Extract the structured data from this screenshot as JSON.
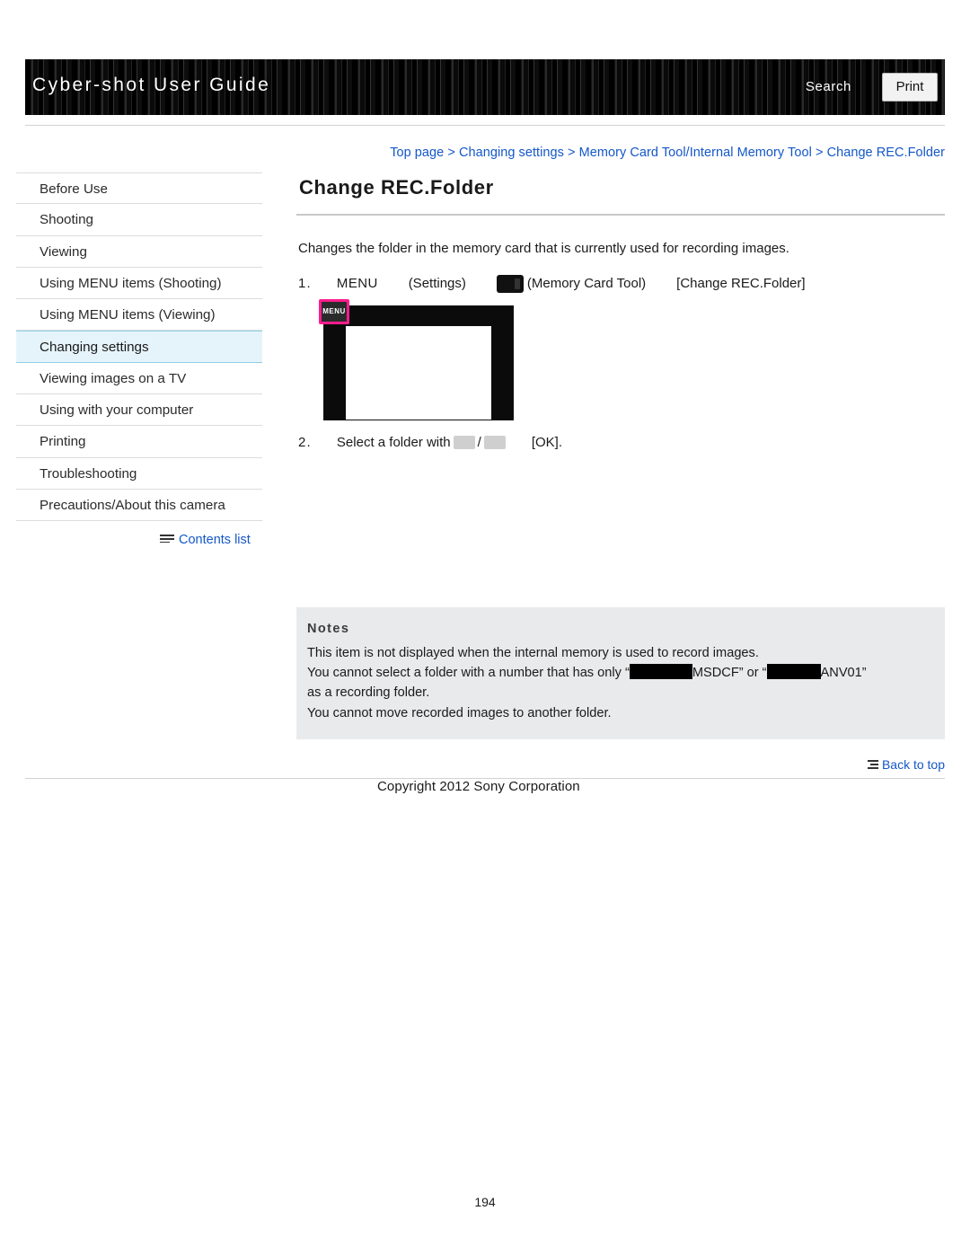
{
  "header": {
    "title": "Cyber-shot User Guide",
    "search_label": "Search",
    "print_label": "Print"
  },
  "breadcrumb": {
    "items": [
      "Top page",
      "Changing settings",
      "Memory Card Tool/Internal Memory Tool",
      "Change REC.Folder"
    ],
    "separator": ">"
  },
  "sidebar": {
    "items": [
      {
        "label": "Before Use"
      },
      {
        "label": "Shooting"
      },
      {
        "label": "Viewing"
      },
      {
        "label": "Using MENU items (Shooting)"
      },
      {
        "label": "Using MENU items (Viewing)"
      },
      {
        "label": "Changing settings"
      },
      {
        "label": "Viewing images on a TV"
      },
      {
        "label": "Using with your computer"
      },
      {
        "label": "Printing"
      },
      {
        "label": "Troubleshooting"
      },
      {
        "label": "Precautions/About this camera"
      }
    ],
    "active_index": 5,
    "contents_list_label": "Contents list"
  },
  "main": {
    "title": "Change REC.Folder",
    "intro": "Changes the folder in the memory card that is currently used for recording images.",
    "step1": {
      "number": "1.",
      "menu": "MENU",
      "settings": "(Settings)",
      "memory_card_tool": "(Memory Card Tool)",
      "target": "[Change REC.Folder]"
    },
    "screen": {
      "menu_badge_label": "MENU"
    },
    "step2": {
      "number": "2.",
      "text_before": "Select a folder with",
      "separator": "/",
      "text_after": "[OK]."
    }
  },
  "notes": {
    "title": "Notes",
    "lines": [
      "This item is not displayed when the internal memory is used to record images.",
      "as a recording folder.",
      "You cannot move recorded images to another folder."
    ],
    "redacted_line": {
      "prefix": "You cannot select a folder with a number that has only “",
      "mid": "MSDCF” or “",
      "suffix": "ANV01”"
    }
  },
  "footer": {
    "back_to_top": "Back to top",
    "copyright": "Copyright 2012 Sony Corporation",
    "page_number": "194"
  }
}
